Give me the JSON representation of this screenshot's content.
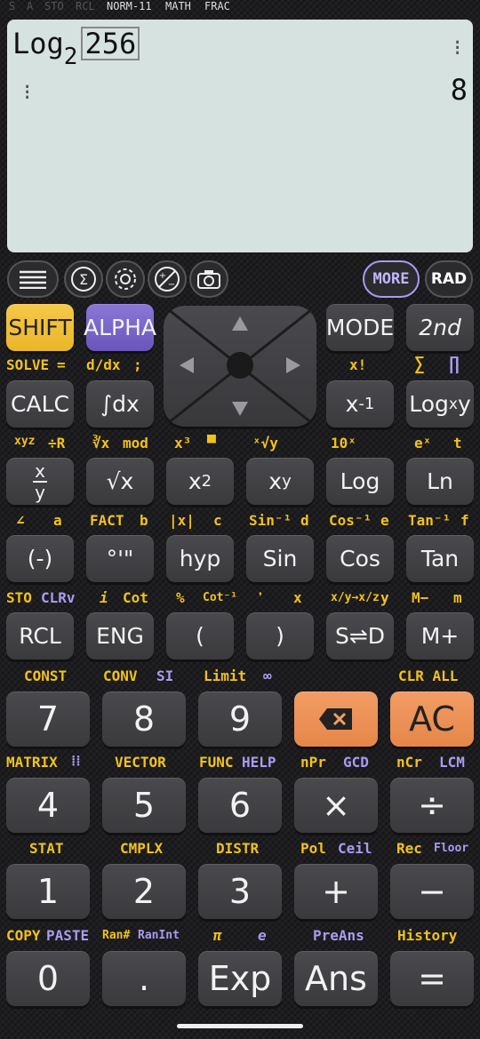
{
  "status_bar": {
    "flags_dim": [
      "S",
      "A",
      "STO",
      "RCL"
    ],
    "mode": "NORM-11",
    "math": "MATH",
    "frac": "FRAC"
  },
  "display": {
    "expression_func": "Log",
    "expression_base": "2",
    "expression_arg": "256",
    "result": "8"
  },
  "toolbar": {
    "more_label": "MORE",
    "angle_label": "RAD",
    "icons": [
      "menu-icon",
      "sigma-icon",
      "gear-icon",
      "plus-minus-icon",
      "camera-icon"
    ]
  },
  "row_a": {
    "shift": "SHIFT",
    "alpha": "ALPHA",
    "mode": "MODE",
    "second": "2nd",
    "sub_solve": "SOLVE",
    "sub_eq": "=",
    "sub_ddx": "d/dx",
    "sub_semicolon": ";",
    "sub_xfact": "x!",
    "sub_sigma": "∑",
    "sub_pi": "∏"
  },
  "row_b": {
    "calc": "CALC",
    "int": "∫dx",
    "xinv_base": "x",
    "xinv_exp": "-1",
    "logxy_main": "Log",
    "logxy_sub": "x",
    "logxy_y": "y",
    "sub_frac_xyz": "xyz",
    "sub_r": "÷R",
    "sub_cbrt": "∛x",
    "sub_mod": "mod",
    "sub_x3": "x³",
    "sub_box": "▀",
    "sub_xroot": "ˣ√y",
    "sub_10x": "10ˣ",
    "sub_ex": "eˣ",
    "sub_t": "t"
  },
  "row_c": {
    "frac_top": "x",
    "frac_bot": "y",
    "sqrt": "√x",
    "x2_base": "x",
    "x2_exp": "2",
    "xy_base": "x",
    "xy_exp": "y",
    "log": "Log",
    "ln": "Ln",
    "sub_angle": "∠",
    "sub_a": "a",
    "sub_fact": "FACT",
    "sub_b": "b",
    "sub_abs": "|x|",
    "sub_c": "c",
    "sub_sin_inv": "Sin⁻¹",
    "sub_d": "d",
    "sub_cos_inv": "Cos⁻¹",
    "sub_e": "e",
    "sub_tan_inv": "Tan⁻¹",
    "sub_f": "f"
  },
  "row_d": {
    "neg": "(-)",
    "deg": "°'\"",
    "hyp": "hyp",
    "sin": "Sin",
    "cos": "Cos",
    "tan": "Tan",
    "sub_sto": "STO",
    "sub_clrv": "CLRv",
    "sub_i": "i",
    "sub_cot": "Cot",
    "sub_pct": "%",
    "sub_cotinv": "Cot⁻¹",
    "sub_comma": "❜",
    "sub_x": "x",
    "sub_conv": "x/y→x/z",
    "sub_y": "y",
    "sub_mminus": "M−",
    "sub_m": "m"
  },
  "row_e": {
    "rcl": "RCL",
    "eng": "ENG",
    "lparen": "(",
    "rparen": ")",
    "sd": "S⇌D",
    "mplus": "M+",
    "sub_const": "CONST",
    "sub_conv": "CONV",
    "sub_si": "SI",
    "sub_limit": "Limit",
    "sub_inf": "∞",
    "sub_clrall": "CLR ALL"
  },
  "num_row1": {
    "k7": "7",
    "k8": "8",
    "k9": "9",
    "ac": "AC",
    "sub_matrix": "MATRIX",
    "sub_vector": "VECTOR",
    "sub_func": "FUNC",
    "sub_help": "HELP",
    "sub_npr": "nPr",
    "sub_gcd": "GCD",
    "sub_ncr": "nCr",
    "sub_lcm": "LCM"
  },
  "num_row2": {
    "k4": "4",
    "k5": "5",
    "k6": "6",
    "mul": "×",
    "div": "÷",
    "sub_stat": "STAT",
    "sub_cmplx": "CMPLX",
    "sub_distr": "DISTR",
    "sub_pol": "Pol",
    "sub_ceil": "Ceil",
    "sub_rec": "Rec",
    "sub_floor": "Floor"
  },
  "num_row3": {
    "k1": "1",
    "k2": "2",
    "k3": "3",
    "plus": "+",
    "minus": "−",
    "sub_copy": "COPY",
    "sub_paste": "PASTE",
    "sub_ranh": "Ran#",
    "sub_ranint": "RanInt",
    "sub_pi": "π",
    "sub_e": "e",
    "sub_preans": "PreAns",
    "sub_history": "History"
  },
  "num_row4": {
    "k0": "0",
    "dot": ".",
    "exp": "Exp",
    "ans": "Ans",
    "eq": "="
  },
  "colors": {
    "accent_yellow": "#f2c21a",
    "accent_purple": "#7b66c9",
    "accent_orange": "#ee9158",
    "display_bg": "#d6e2e0"
  }
}
